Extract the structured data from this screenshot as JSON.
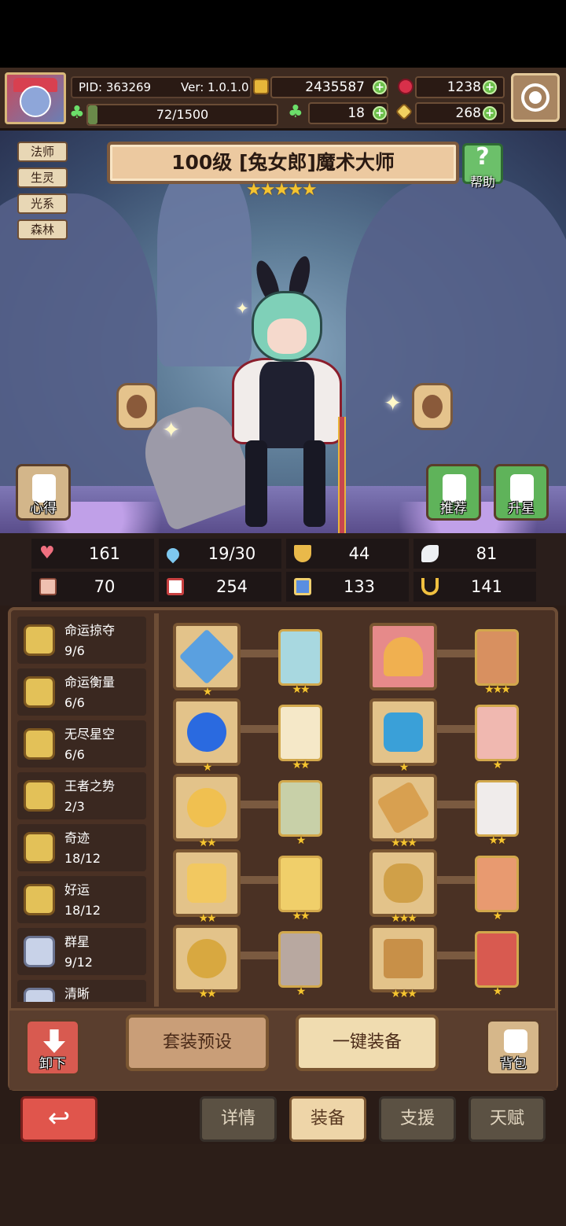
{
  "header": {
    "pid": "PID: 363269",
    "version": "Ver: 1.0.1.0",
    "gold": "2435587",
    "ruby": "1238",
    "clover_count": "18",
    "key_count": "268",
    "stamina": "72/1500",
    "stamina_fraction": 0.048
  },
  "hero": {
    "tags": [
      "法师",
      "生灵",
      "光系",
      "森林"
    ],
    "title": "100级 [兔女郎]魔术大师",
    "stars": "★★★★★",
    "help_label": "帮助",
    "left_button": "心得",
    "recommend_button": "推荐",
    "upgrade_button": "升星"
  },
  "stats": {
    "hp": "161",
    "mana": "19/30",
    "defense": "44",
    "speed": "81",
    "attack": "70",
    "magic": "254",
    "power": "133",
    "luck": "141"
  },
  "sets": [
    {
      "name": "命运掠夺",
      "count": "9/6"
    },
    {
      "name": "命运衡量",
      "count": "6/6"
    },
    {
      "name": "无尽星空",
      "count": "6/6"
    },
    {
      "name": "王者之势",
      "count": "2/3"
    },
    {
      "name": "奇迹",
      "count": "18/12"
    },
    {
      "name": "好运",
      "count": "18/12"
    },
    {
      "name": "群星",
      "count": "9/12"
    },
    {
      "name": "清晰",
      "count": ""
    }
  ],
  "equipment": {
    "stars_1": "★",
    "stars_2": "★★",
    "stars_3": "★★★"
  },
  "actions": {
    "unequip": "卸下",
    "preset": "套装预设",
    "auto_equip": "一键装备",
    "bag": "背包"
  },
  "tabs": {
    "back": "↩",
    "details": "详情",
    "equip": "装备",
    "support": "支援",
    "talent": "天赋"
  }
}
